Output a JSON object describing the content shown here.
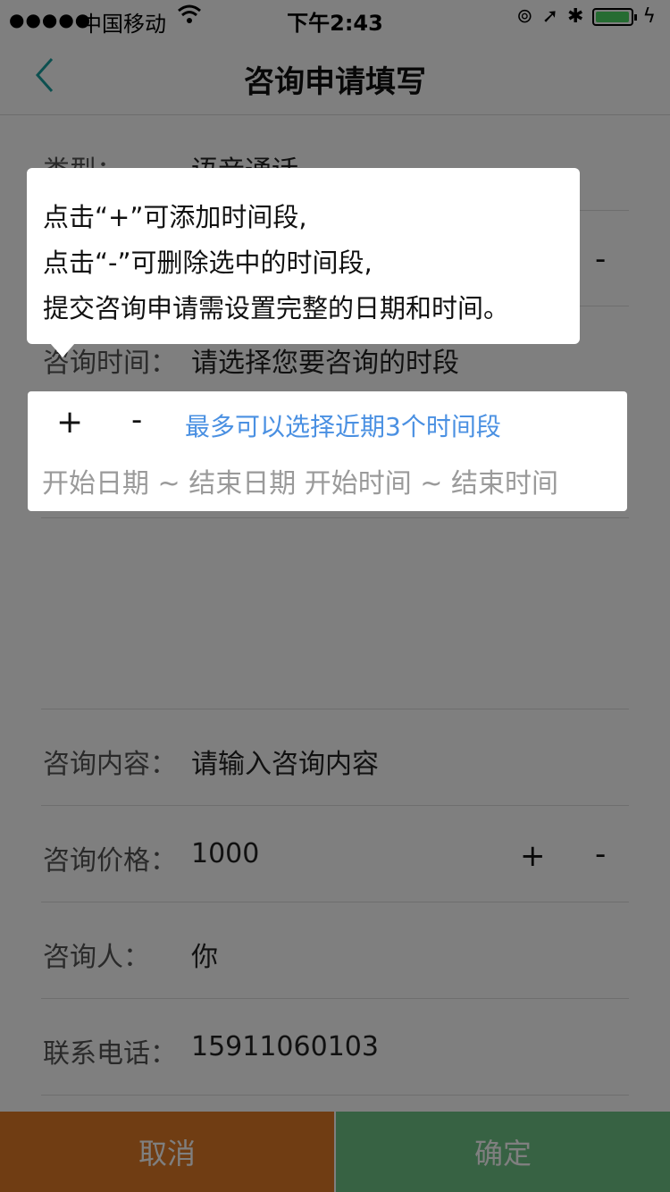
{
  "status_bar": {
    "signal": "●●●●●",
    "carrier": "中国移动",
    "time": "下午2:43",
    "battery_level": 0.95,
    "colors": {
      "battery": "#4cd964"
    }
  },
  "nav": {
    "title": "咨询申请填写",
    "back_icon": "chevron-left-icon"
  },
  "form": {
    "type": {
      "label": "类型：",
      "value": "语音通话"
    },
    "row2": {
      "minus": "-"
    },
    "consult_time": {
      "label": "咨询时间：",
      "value": "请选择您要咨询的时段"
    },
    "time_picker": {
      "plus": "+",
      "minus": "-",
      "hint": "最多可以选择近期3个时间段",
      "range": "开始日期 ~ 结束日期 开始时间 ~ 结束时间"
    },
    "content": {
      "label": "咨询内容：",
      "value": "请输入咨询内容"
    },
    "price": {
      "label": "咨询价格：",
      "value": "1000",
      "plus": "+",
      "minus": "-"
    },
    "person": {
      "label": "咨询人：",
      "value": "你"
    },
    "phone": {
      "label": "联系电话：",
      "value": "15911060103"
    }
  },
  "tooltip": {
    "lines": [
      "点击“+”可添加时间段,",
      "点击“-”可删除选中的时间段,",
      "提交咨询申请需设置完整的日期和时间。"
    ]
  },
  "bottom": {
    "cancel": "取消",
    "confirm": "确定"
  },
  "colors": {
    "cancel": "#e07a26",
    "confirm": "#6ec486",
    "hint": "#4a90e2",
    "back": "#1aa0a0"
  }
}
